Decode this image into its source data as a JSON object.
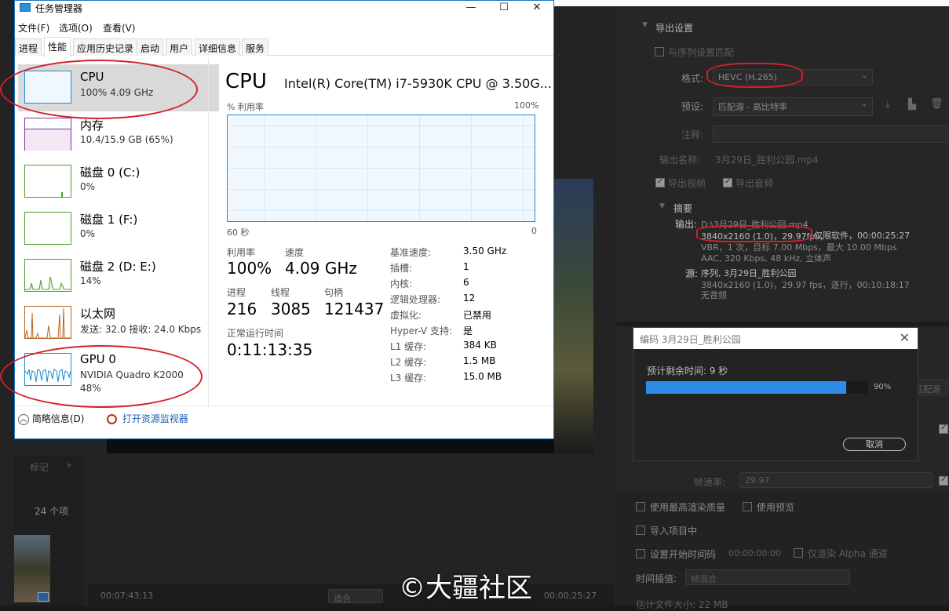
{
  "task_manager": {
    "title": "任务管理器",
    "menu": [
      "文件(F)",
      "选项(O)",
      "查看(V)"
    ],
    "tabs": [
      "进程",
      "性能",
      "应用历史记录",
      "启动",
      "用户",
      "详细信息",
      "服务"
    ],
    "active_tab": "性能",
    "resources": [
      {
        "name": "CPU",
        "sub": "100% 4.09 GHz",
        "color": "#1a8ad4"
      },
      {
        "name": "内存",
        "sub": "10.4/15.9 GB (65%)",
        "color": "#8b2fa0"
      },
      {
        "name": "磁盘 0 (C:)",
        "sub": "0%",
        "color": "#4aa02c"
      },
      {
        "name": "磁盘 1 (F:)",
        "sub": "0%",
        "color": "#4aa02c"
      },
      {
        "name": "磁盘 2 (D: E:)",
        "sub": "14%",
        "color": "#4aa02c"
      },
      {
        "name": "以太网",
        "sub": "发送: 32.0 接收: 24.0 Kbps",
        "color": "#b5651d"
      },
      {
        "name": "GPU 0",
        "sub": "NVIDIA Quadro K2000",
        "sub2": "48%",
        "color": "#1a8ad4"
      }
    ],
    "detail": {
      "heading": "CPU",
      "model": "Intel(R) Core(TM) i7-5930K CPU @ 3.50G...",
      "graph_label": "% 利用率",
      "graph_max": "100%",
      "graph_time": "60 秒",
      "graph_min": "0",
      "utilization_label": "利用率",
      "utilization": "100%",
      "speed_label": "速度",
      "speed": "4.09 GHz",
      "processes_label": "进程",
      "processes": "216",
      "threads_label": "线程",
      "threads": "3085",
      "handles_label": "句柄",
      "handles": "121437",
      "uptime_label": "正常运行时间",
      "uptime": "0:11:13:35",
      "specs": [
        {
          "k": "基准速度:",
          "v": "3.50 GHz"
        },
        {
          "k": "插槽:",
          "v": "1"
        },
        {
          "k": "内核:",
          "v": "6"
        },
        {
          "k": "逻辑处理器:",
          "v": "12"
        },
        {
          "k": "虚拟化:",
          "v": "已禁用"
        },
        {
          "k": "Hyper-V 支持:",
          "v": "是"
        },
        {
          "k": "L1 缓存:",
          "v": "384 KB"
        },
        {
          "k": "L2 缓存:",
          "v": "1.5 MB"
        },
        {
          "k": "L3 缓存:",
          "v": "15.0 MB"
        }
      ]
    },
    "footer": {
      "brief": "简略信息(D)",
      "monitor": "打开资源监视器"
    }
  },
  "premiere": {
    "export_settings_title": "导出设置",
    "match_sequence": "与序列设置匹配",
    "format_label": "格式:",
    "format_value": "HEVC (H.265)",
    "preset_label": "预设:",
    "preset_value": "匹配源 - 高比特率",
    "comment_label": "注释:",
    "output_name_label": "输出名称:",
    "output_name": "3月29日_胜利公园.mp4",
    "export_video": "导出视频",
    "export_audio": "导出音频",
    "summary_title": "摘要",
    "output_label": "输出:",
    "output_line1": "D:\\3月29日_胜利公园.mp4",
    "output_res": "3840x2160 (1.0)，29.97fps，",
    "output_line2_rest": "仅限软件，00:00:25:27",
    "output_line3": "VBR，1 次，目标 7.00 Mbps，最大 10.00 Mbps",
    "output_line4": "AAC, 320 Kbps, 48 kHz, 立体声",
    "source_label": "源:",
    "source_line1": "序列, 3月29日_胜利公园",
    "source_line2": "3840x2160 (1.0)，29.97 fps，逐行，00:10:18:17",
    "source_line3": "无音频",
    "frame_rate_label": "帧速率:",
    "frame_rate_value": "29.97",
    "max_render_quality": "使用最高渲染质量",
    "use_previews": "使用预览",
    "import_into_project": "导入项目中",
    "set_start_timecode": "设置开始时间码",
    "start_timecode": "00:00:00:00",
    "render_alpha_only": "仅渲染 Alpha 通道",
    "time_interp_label": "时间插值:",
    "time_interp_value": "帧混合",
    "estimated_size": "估计文件大小: 22 MB",
    "match_source_btn": "匹配源",
    "items_count": "24 个项",
    "markers_tab": "标记",
    "timecode_left": "00:07:43:13",
    "fit_label": "适合",
    "timecode_right": "00:00:25:27"
  },
  "encoding_dialog": {
    "title": "编码 3月29日_胜利公园",
    "remaining": "预计剩余时间: 9 秒",
    "progress": 0.9,
    "progress_label": "90%",
    "cancel": "取消"
  },
  "watermark": "©大疆社区"
}
